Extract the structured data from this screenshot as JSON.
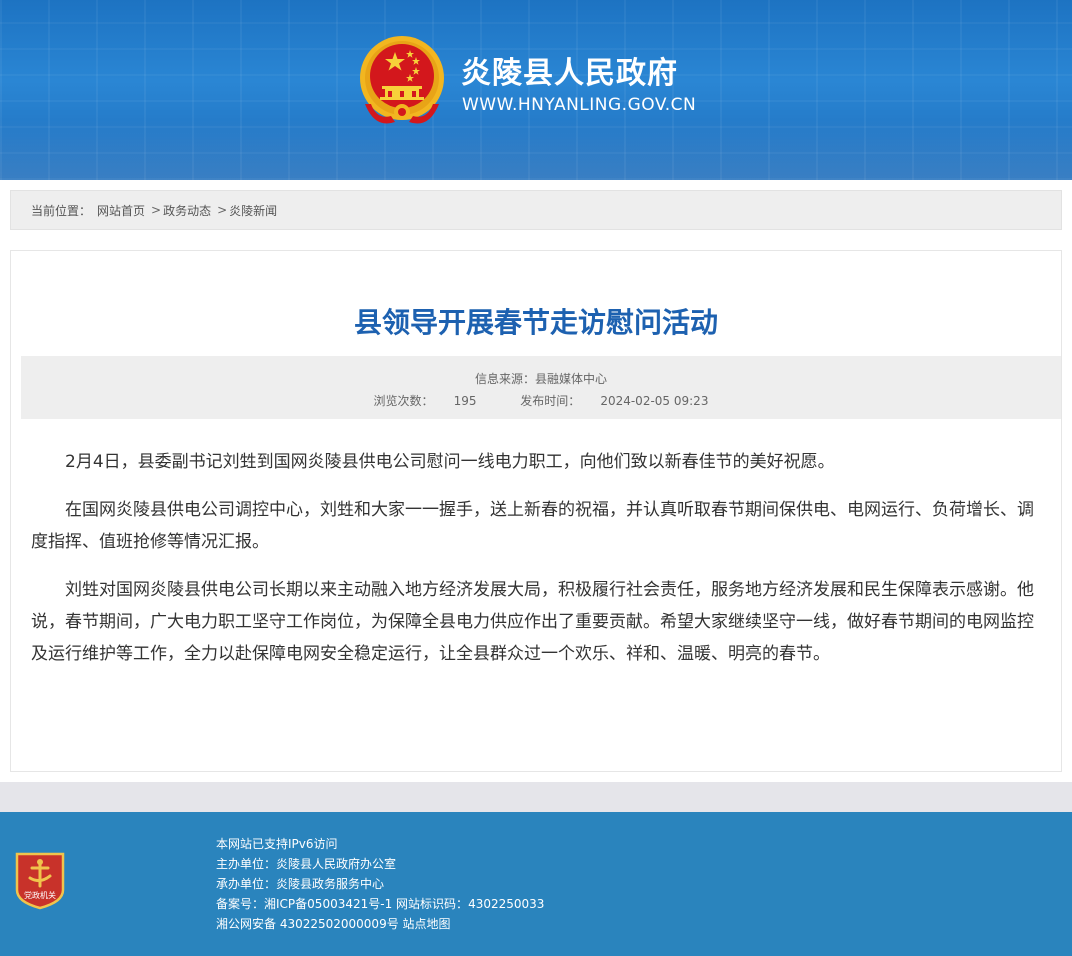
{
  "header": {
    "site_title": "炎陵县人民政府",
    "site_url": "WWW.HNYANLING.GOV.CN",
    "emblem_icon": "national-emblem-icon"
  },
  "breadcrumb": {
    "label": "当前位置：",
    "items": [
      "网站首页",
      "政务动态",
      "炎陵新闻"
    ],
    "separator": ">"
  },
  "article": {
    "title": "县领导开展春节走访慰问活动",
    "source_label": "信息来源：",
    "source_value": "县融媒体中心",
    "views_label": "浏览次数：",
    "views_value": "195",
    "date_label": "发布时间：",
    "date_value": "2024-02-05 09:23",
    "paragraphs": [
      "2月4日，县委副书记刘甡到国网炎陵县供电公司慰问一线电力职工，向他们致以新春佳节的美好祝愿。",
      "在国网炎陵县供电公司调控中心，刘甡和大家一一握手，送上新春的祝福，并认真听取春节期间保供电、电网运行、负荷增长、调度指挥、值班抢修等情况汇报。",
      "刘甡对国网炎陵县供电公司长期以来主动融入地方经济发展大局，积极履行社会责任，服务地方经济发展和民生保障表示感谢。他说，春节期间，广大电力职工坚守工作岗位，为保障全县电力供应作出了重要贡献。希望大家继续坚守一线，做好春节期间的电网监控及运行维护等工作，全力以赴保障电网安全稳定运行，让全县群众过一个欢乐、祥和、温暖、明亮的春节。"
    ]
  },
  "footer": {
    "badge_icon": "party-government-badge-icon",
    "badge_text": "党政机关",
    "ipv6": "本网站已支持IPv6访问",
    "host_label": "主办单位：",
    "host_value": "炎陵县人民政府办公室",
    "organizer_label": "承办单位：",
    "organizer_value": "炎陵县政务服务中心",
    "icp_label": "备案号：",
    "icp_value": "湘ICP备05003421号-1",
    "site_id_label": "网站标识码：",
    "site_id_value": "4302250033",
    "police_record": "湘公网安备 43022502000009号",
    "sitemap": "站点地图"
  },
  "colors": {
    "header_blue": "#1d73c2",
    "title_blue": "#1d61b0",
    "footer_blue": "#2a84bd",
    "emblem_red": "#d3171c",
    "emblem_gold": "#f2b620"
  }
}
